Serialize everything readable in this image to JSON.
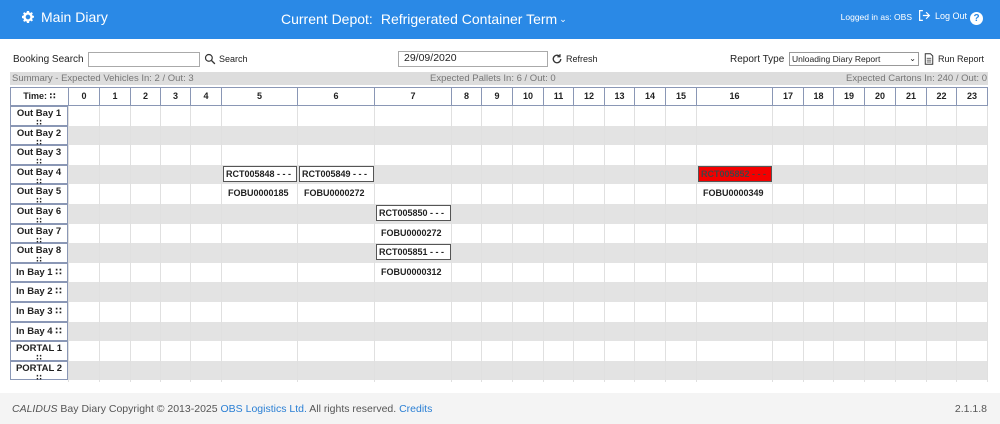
{
  "header": {
    "title": "Main Diary",
    "depot_label": "Current Depot:",
    "depot_value": "Refrigerated Container Term",
    "logged_in": "Logged in as: OBS",
    "logout": "Log Out",
    "help": "?"
  },
  "toolbar": {
    "booking_search_label": "Booking Search",
    "booking_search_value": "",
    "search_label": "Search",
    "date_value": "29/09/2020",
    "refresh_label": "Refresh",
    "report_type_label": "Report Type",
    "report_type_value": "Unloading Diary Report",
    "run_report_label": "Run Report"
  },
  "summary": {
    "vehicles": "Summary - Expected Vehicles In: 2 / Out: 3",
    "pallets": "Expected Pallets In: 6 / Out: 0",
    "cartons": "Expected Cartons In: 240 / Out: 0"
  },
  "grid": {
    "time_label": "Time: ∷",
    "hours": [
      "0",
      "1",
      "2",
      "3",
      "4",
      "5",
      "6",
      "7",
      "8",
      "9",
      "10",
      "11",
      "12",
      "13",
      "14",
      "15",
      "16",
      "17",
      "18",
      "19",
      "20",
      "21",
      "22",
      "23"
    ],
    "rows": [
      {
        "label": "Out Bay 1",
        "handle": "∷"
      },
      {
        "label": "Out Bay 2",
        "handle": "∷"
      },
      {
        "label": "Out Bay 3",
        "handle": "∷"
      },
      {
        "label": "Out Bay 4",
        "handle": "∷"
      },
      {
        "label": "Out Bay 5",
        "handle": "∷"
      },
      {
        "label": "Out Bay 6",
        "handle": "∷"
      },
      {
        "label": "Out Bay 7",
        "handle": "∷"
      },
      {
        "label": "Out Bay 8",
        "handle": "∷"
      },
      {
        "label": "In Bay 1 ∷",
        "handle": ""
      },
      {
        "label": "In Bay 2 ∷",
        "handle": ""
      },
      {
        "label": "In Bay 3 ∷",
        "handle": ""
      },
      {
        "label": "In Bay 4 ∷",
        "handle": ""
      },
      {
        "label": "PORTAL 1",
        "handle": "∷"
      },
      {
        "label": "PORTAL 2",
        "handle": "∷"
      }
    ],
    "bookings": [
      {
        "id": "RCT005848 - - -",
        "fobu": "FOBU0000185",
        "row": 3,
        "hour": 5,
        "status_color": "#ffffff"
      },
      {
        "id": "RCT005849 - - -",
        "fobu": "FOBU0000272",
        "row": 3,
        "hour": 6,
        "status_color": "#ffffff"
      },
      {
        "id": "RCT005852 - - -",
        "fobu": "FOBU0000349",
        "row": 3,
        "hour": 16,
        "status_color": "#f40000"
      },
      {
        "id": "RCT005850 - - -",
        "fobu": "FOBU0000272",
        "row": 5,
        "hour": 7,
        "status_color": "#ffffff"
      },
      {
        "id": "RCT005851 - - -",
        "fobu": "FOBU0000312",
        "row": 7,
        "hour": 7,
        "status_color": "#ffffff"
      }
    ]
  },
  "footer": {
    "brand": "CALIDUS",
    "text1": " Bay Diary Copyright © 2013-2025 ",
    "company": "OBS Logistics Ltd.",
    "text2": " All rights reserved. ",
    "credits": "Credits",
    "version": "2.1.1.8"
  },
  "colors": {
    "accent": "#2a89e6",
    "alert": "#f40000"
  }
}
